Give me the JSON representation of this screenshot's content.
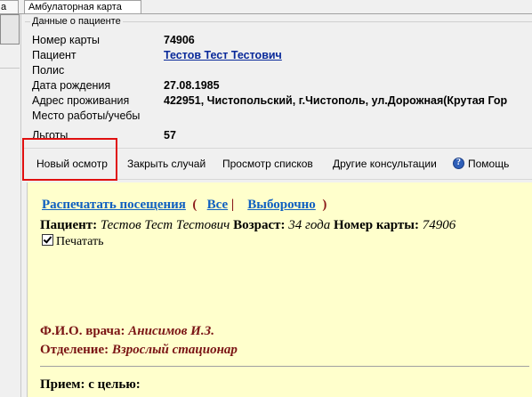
{
  "tabs": {
    "left": "a",
    "ambulatory": "Амбулаторная карта"
  },
  "patient_box": {
    "title": "Данные о пациенте",
    "card_number_label": "Номер карты",
    "card_number": "74906",
    "patient_label": "Пациент",
    "patient_name": "Тестов Тест Тестович",
    "policy_label": "Полис",
    "birth_label": "Дата рождения",
    "birth_date": "27.08.1985",
    "address_label": "Адрес проживания",
    "address": "422951, Чистопольский, г.Чистополь, ул.Дорожная(Крутая Гор",
    "work_label": "Место работы/учебы",
    "benefits_label": "Льготы",
    "benefits": "57"
  },
  "toolbar": {
    "new_exam": "Новый осмотр",
    "close_case": "Закрыть случай",
    "view_lists": "Просмотр списков",
    "other_consult": "Другие консультации",
    "help": "Помощь"
  },
  "content": {
    "print_visits": "Распечатать посещения",
    "paren_open": "(",
    "all": "Все",
    "pipe": "|",
    "selective": "Выборочно",
    "paren_close": ")",
    "patient_label": "Пациент:",
    "patient_name": "Тестов Тест Тестович",
    "age_label": "Возраст:",
    "age": "34 года",
    "card_label": "Номер карты:",
    "card_number": "74906",
    "print_checkbox": "Печатать",
    "doctor_label": "Ф.И.О. врача:",
    "doctor_name": "Анисимов И.З.",
    "dept_label": "Отделение:",
    "dept_name": "Взрослый стационар",
    "reception": "Прием: с целью:"
  },
  "colors": {
    "content_bg": "#ffffcc",
    "highlight": "#e01010",
    "link": "#1060c0",
    "maroon": "#7a1414"
  }
}
